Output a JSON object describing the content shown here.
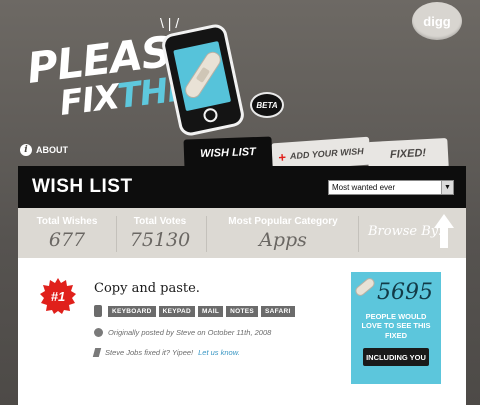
{
  "logo": {
    "please": "PLEASE",
    "fix": "FIX",
    "the": "THE",
    "beta": "BETA"
  },
  "digg_badge": "digg",
  "nav": {
    "about": "ABOUT"
  },
  "tabs": [
    {
      "label": "WISH LIST",
      "active": true
    },
    {
      "label": "ADD YOUR WISH",
      "active": false
    },
    {
      "label": "FIXED!",
      "active": false
    }
  ],
  "wish_list": {
    "title": "WISH LIST",
    "sort_selected": "Most wanted ever"
  },
  "stats": {
    "total_wishes_label": "Total Wishes",
    "total_wishes_value": "677",
    "total_votes_label": "Total Votes",
    "total_votes_value": "75130",
    "popular_label": "Most Popular Category",
    "popular_value": "Apps",
    "browse_label": "Browse By:"
  },
  "wish": {
    "rank": "#1",
    "title": "Copy and paste.",
    "tags": [
      "KEYBOARD",
      "KEYPAD",
      "MAIL",
      "NOTES",
      "SAFARI"
    ],
    "posted": "Originally posted by Steve on October 11th, 2008",
    "fixed_text": "Steve Jobs fixed it? Yipee!",
    "fixed_link": "Let us know.",
    "vote_count": "5695",
    "vote_caption": "PEOPLE WOULD LOVE TO SEE THIS FIXED",
    "include_button": "INCLUDING YOU"
  },
  "colors": {
    "accent_blue": "#5cc6dc",
    "seal_red": "#e0201b",
    "header_black": "#0d0d0d",
    "link_blue": "#3a97c4"
  }
}
